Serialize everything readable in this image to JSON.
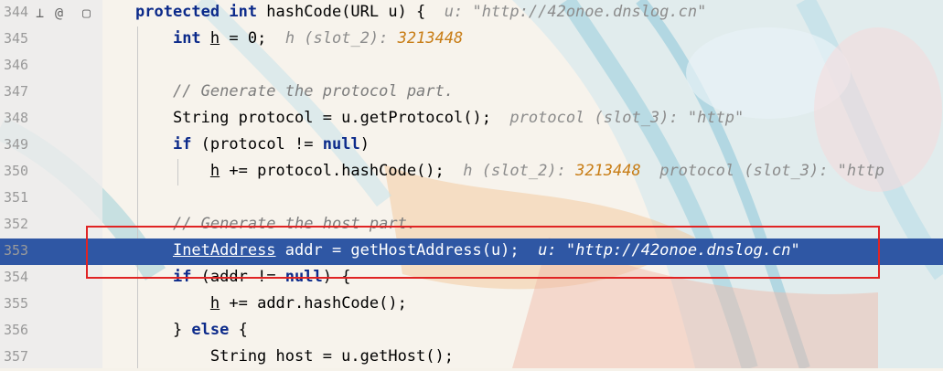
{
  "editor": {
    "lines": [
      {
        "num": "344",
        "segments": [
          {
            "t": "protected int ",
            "c": "kw"
          },
          {
            "t": "hashCode(URL u) {"
          },
          {
            "t": "  u: \"http://42onoe.dnslog.cn\"",
            "c": "hint"
          }
        ]
      },
      {
        "num": "345",
        "segments": [
          {
            "t": "    "
          },
          {
            "t": "int ",
            "c": "kw"
          },
          {
            "t": "h",
            "c": "ul"
          },
          {
            "t": " = 0;"
          },
          {
            "t": "  h (slot_2): ",
            "c": "hint"
          },
          {
            "t": "3213448",
            "c": "num-hint"
          }
        ]
      },
      {
        "num": "346",
        "segments": []
      },
      {
        "num": "347",
        "segments": [
          {
            "t": "    "
          },
          {
            "t": "// Generate the protocol part.",
            "c": "cm"
          }
        ]
      },
      {
        "num": "348",
        "segments": [
          {
            "t": "    String protocol = u.getProtocol();"
          },
          {
            "t": "  protocol (slot_3): \"http\"",
            "c": "hint"
          }
        ]
      },
      {
        "num": "349",
        "segments": [
          {
            "t": "    "
          },
          {
            "t": "if ",
            "c": "kw"
          },
          {
            "t": "(protocol != "
          },
          {
            "t": "null",
            "c": "kw"
          },
          {
            "t": ")"
          }
        ]
      },
      {
        "num": "350",
        "segments": [
          {
            "t": "        "
          },
          {
            "t": "h",
            "c": "ul"
          },
          {
            "t": " += protocol.hashCode();"
          },
          {
            "t": "  h (slot_2): ",
            "c": "hint"
          },
          {
            "t": "3213448",
            "c": "num-hint"
          },
          {
            "t": "  protocol (slot_3): \"http",
            "c": "hint"
          }
        ]
      },
      {
        "num": "351",
        "segments": []
      },
      {
        "num": "352",
        "segments": [
          {
            "t": "    "
          },
          {
            "t": "// Generate the host part.",
            "c": "cm"
          }
        ]
      },
      {
        "num": "353",
        "selected": true,
        "segments": [
          {
            "t": "    "
          },
          {
            "t": "InetAddress",
            "c": "ul"
          },
          {
            "t": " addr = getHostAddress(u);"
          },
          {
            "t": "  u: \"http://42onoe.dnslog.cn\"",
            "c": "hint"
          }
        ]
      },
      {
        "num": "354",
        "segments": [
          {
            "t": "    "
          },
          {
            "t": "if ",
            "c": "kw"
          },
          {
            "t": "(addr != "
          },
          {
            "t": "null",
            "c": "kw"
          },
          {
            "t": ") {"
          }
        ]
      },
      {
        "num": "355",
        "segments": [
          {
            "t": "        "
          },
          {
            "t": "h",
            "c": "ul"
          },
          {
            "t": " += addr.hashCode();"
          }
        ]
      },
      {
        "num": "356",
        "segments": [
          {
            "t": "    } "
          },
          {
            "t": "else ",
            "c": "kw"
          },
          {
            "t": "{"
          }
        ]
      },
      {
        "num": "357",
        "segments": [
          {
            "t": "        String host = u.getHost();"
          }
        ]
      }
    ]
  }
}
